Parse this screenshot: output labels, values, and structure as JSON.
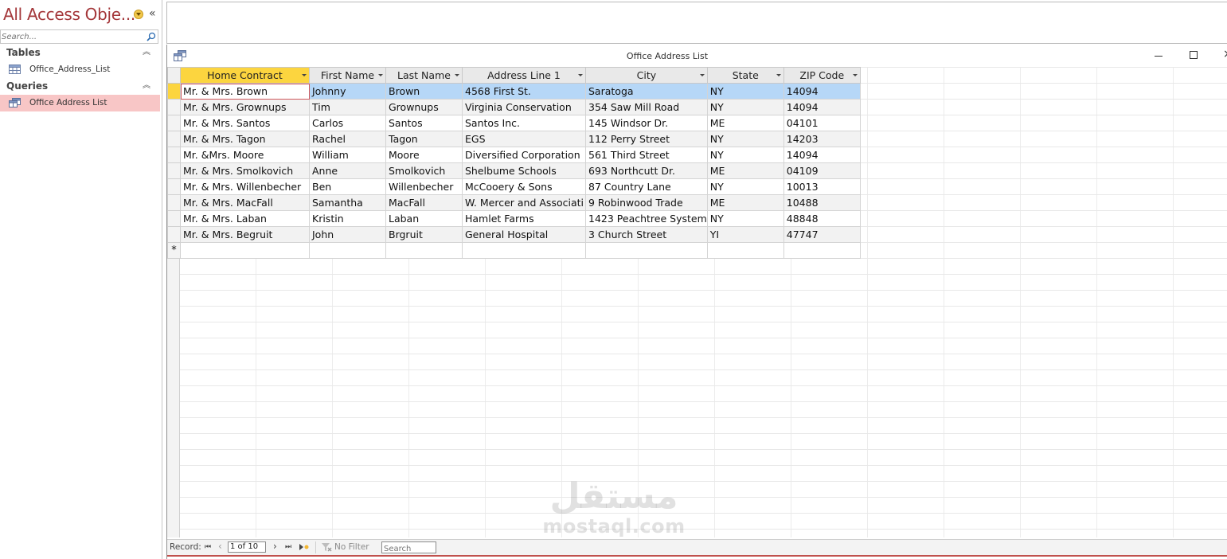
{
  "nav": {
    "title": "All Access Obje...",
    "collapse_glyph": "«",
    "search_placeholder": "Search...",
    "groups": [
      {
        "label": "Tables",
        "items": [
          {
            "label": "Office_Address_List",
            "icon": "table-icon"
          }
        ]
      },
      {
        "label": "Queries",
        "items": [
          {
            "label": "Office Address List",
            "icon": "query-icon",
            "selected": true
          }
        ]
      }
    ]
  },
  "document": {
    "title": "Office Address List",
    "close_glyph": "×"
  },
  "datasheet": {
    "columns": [
      "Home Contract",
      "First Name",
      "Last Name",
      "Address Line 1",
      "City",
      "State",
      "ZIP Code"
    ],
    "active_column": 0,
    "rows": [
      [
        "Mr. & Mrs.  Brown",
        "Johnny",
        "Brown",
        "4568 First St.",
        "Saratoga",
        "NY",
        "14094"
      ],
      [
        "Mr. & Mrs.  Grownups",
        "Tim",
        "Grownups",
        "Virginia Conservation",
        "354 Saw Mill Road",
        "NY",
        "14094"
      ],
      [
        "Mr. & Mrs.  Santos",
        "Carlos",
        "Santos",
        "Santos Inc.",
        "145 Windsor Dr.",
        "ME",
        "04101"
      ],
      [
        "Mr. & Mrs. Tagon",
        "Rachel",
        "Tagon",
        "EGS",
        "112 Perry Street",
        "NY",
        "14203"
      ],
      [
        "Mr. &Mrs. Moore",
        "William",
        "Moore",
        "Diversified Corporation",
        "561 Third Street",
        "NY",
        "14094"
      ],
      [
        "Mr. & Mrs.  Smolkovich",
        "Anne",
        "Smolkovich",
        "Shelbume Schools",
        "693 Northcutt Dr.",
        "ME",
        "04109"
      ],
      [
        "Mr. & Mrs.  Willenbecher",
        "Ben",
        "Willenbecher",
        "McCooery & Sons",
        "87 Country Lane",
        "NY",
        "10013"
      ],
      [
        "Mr. & Mrs.  MacFall",
        "Samantha",
        "MacFall",
        "W. Mercer and Associati",
        "9 Robinwood Trade",
        "ME",
        "10488"
      ],
      [
        "Mr. & Mrs.  Laban",
        "Kristin",
        "Laban",
        "Hamlet Farms",
        "1423 Peachtree System",
        "NY",
        "48848"
      ],
      [
        "Mr. & Mrs.  Begruit",
        "John",
        "Brgruit",
        "General Hospital",
        "3 Church Street",
        "YI",
        "47747"
      ]
    ],
    "current_row": 0,
    "new_row_marker": "*"
  },
  "record_nav": {
    "label": "Record:",
    "first": "⏮",
    "prev": "‹",
    "position": "1 of 10",
    "next": "›",
    "last": "⏭",
    "filter_label": "No Filter",
    "search_placeholder": "Search"
  },
  "watermark": {
    "arabic": "مستقل",
    "latin": "mostaql.com"
  },
  "colors": {
    "nav_title": "#a4373a",
    "selected_nav_item": "#f8c6c6",
    "active_header": "#fcd53f",
    "current_row": "#b6d7f7",
    "status_border": "#c0504d"
  }
}
